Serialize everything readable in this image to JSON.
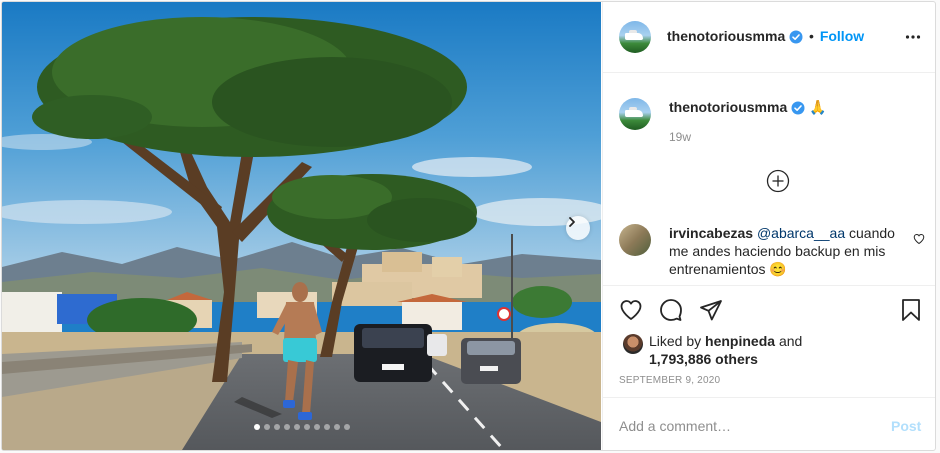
{
  "post": {
    "author": "thenotoriousmma",
    "follow_label": "Follow",
    "separator": "•",
    "caption_emoji": "🙏",
    "caption_age": "19w",
    "carousel": {
      "slide_count": 10,
      "active_slide": 1
    },
    "comments": [
      {
        "username": "irvincabezas",
        "mention": "@abarca__aa",
        "text": " cuando me andes haciendo backup en mis entrenamientos",
        "emoji": "😊"
      }
    ],
    "likes": {
      "prefix": "Liked by ",
      "user": "henpineda",
      "and": " and",
      "others": "1,793,886 others"
    },
    "date": "SEPTEMBER 9, 2020",
    "add_comment_placeholder": "Add a comment…",
    "post_button": "Post"
  },
  "colors": {
    "accent": "#0095f6",
    "verified": "#3897f0",
    "post_disabled": "#b2dffc"
  },
  "icons": [
    "verified-icon",
    "more-icon",
    "chevron-right-icon",
    "load-more-icon",
    "heart-icon",
    "comment-icon",
    "share-icon",
    "bookmark-icon"
  ]
}
